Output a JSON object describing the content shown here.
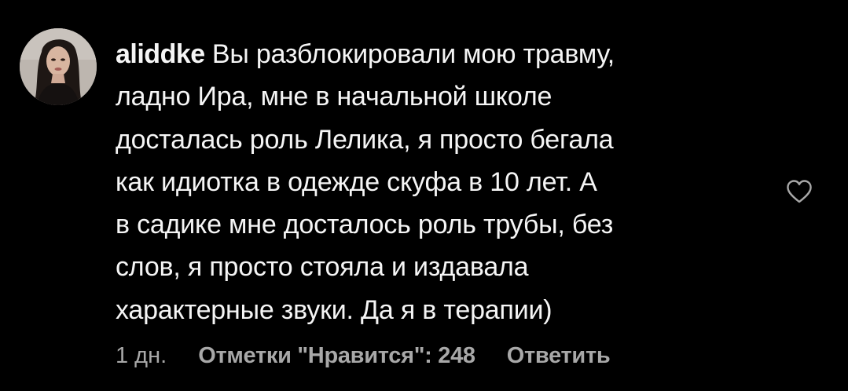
{
  "comment": {
    "username": "aliddke",
    "text": "Вы разблокировали мою травму,\nладно Ира, мне в начальной школе\nдосталась роль Лелика, я просто бегала\nкак идиотка в одежде скуфа в 10 лет. А\nв садике мне досталось роль трубы, без\nслов, я просто стояла и издавала\nхарактерные звуки. Да я в терапии)",
    "time": "1 дн.",
    "likes": "Отметки \"Нравится\": 248",
    "reply_label": "Ответить"
  },
  "icons": {
    "avatar": "user-avatar-photo",
    "like": "heart-outline-icon"
  },
  "colors": {
    "background": "#000000",
    "text": "#f5f5f5",
    "meta": "#a8a8a8"
  }
}
